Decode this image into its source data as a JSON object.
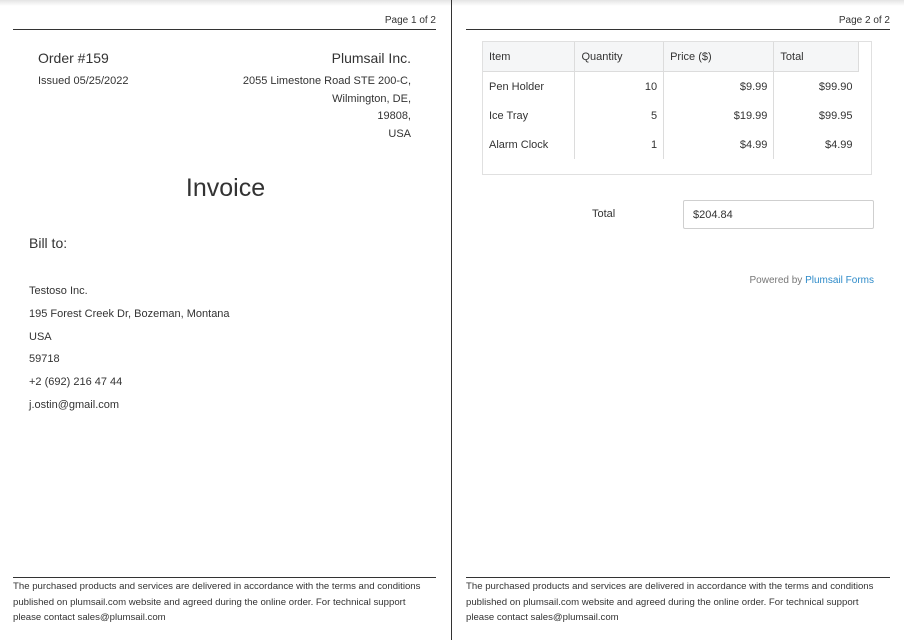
{
  "page1": {
    "page_number": "Page 1 of 2",
    "order_number": "Order #159",
    "issued": "Issued 05/25/2022",
    "company_name": "Plumsail Inc.",
    "company_address": [
      "2055 Limestone Road STE 200-C,",
      "Wilmington, DE,",
      "19808,",
      "USA"
    ],
    "invoice_title": "Invoice",
    "bill_to_label": "Bill to:",
    "bill_to": {
      "name": "Testoso Inc.",
      "street": "195 Forest Creek Dr, Bozeman, Montana",
      "country": "USA",
      "zip": "59718",
      "phone": "+2 (692) 216 47 44",
      "email": "j.ostin@gmail.com"
    },
    "footer": "The purchased products and services are delivered in accordance with the terms and conditions published on plumsail.com website and agreed during the online order. For technical support please contact sales@plumsail.com"
  },
  "page2": {
    "page_number": "Page 2 of 2",
    "table": {
      "headers": [
        "Item",
        "Quantity",
        "Price ($)",
        "Total"
      ],
      "rows": [
        [
          "Pen Holder",
          "10",
          "$9.99",
          "$99.90"
        ],
        [
          "Ice Tray",
          "5",
          "$19.99",
          "$99.95"
        ],
        [
          "Alarm Clock",
          "1",
          "$4.99",
          "$4.99"
        ]
      ]
    },
    "total_label": "Total",
    "total_value": "$204.84",
    "powered_by": "Powered by",
    "powered_link": "Plumsail Forms",
    "footer": "The purchased products and services are delivered in accordance with the terms and conditions published on plumsail.com website and agreed during the online order. For technical support please contact sales@plumsail.com"
  },
  "colors": {
    "link": "#2e8bc9",
    "text": "#333333",
    "header_bg": "#f5f6f7"
  }
}
